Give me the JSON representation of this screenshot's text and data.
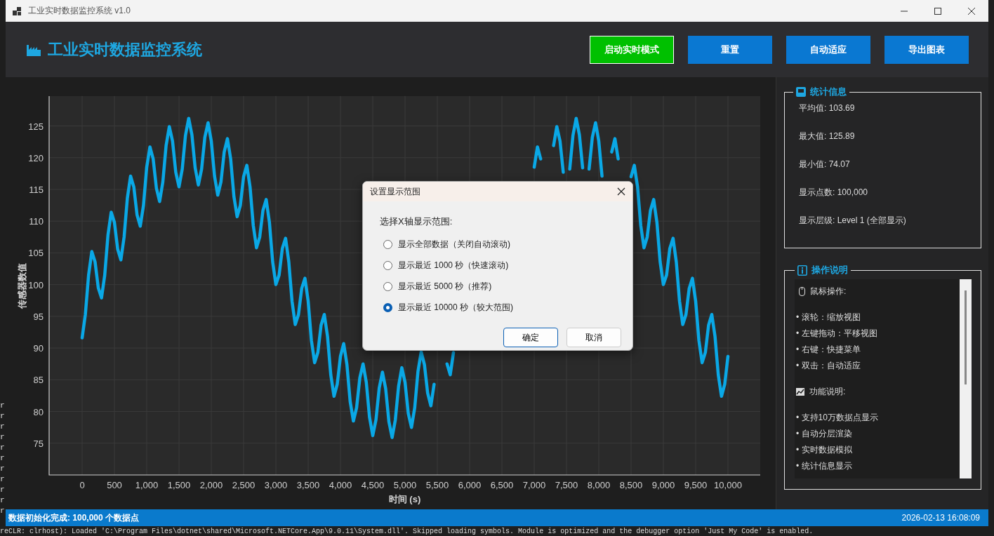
{
  "background": {
    "left_edge_fragments": [
      "r",
      "r",
      "r",
      "r",
      "r",
      "r",
      "r",
      "r",
      "r",
      "r",
      "r"
    ],
    "output_line": "reCLR: clrhost): Loaded 'C:\\Program Files\\dotnet\\shared\\Microsoft.NETCore.App\\9.0.11\\System.dll'. Skipped loading symbols. Module is optimized and the debugger option 'Just My Code' is enabled."
  },
  "window": {
    "title": "工业实时数据监控系统 v1.0"
  },
  "header": {
    "title": "工业实时数据监控系统",
    "buttons": [
      {
        "label": "启动实时模式",
        "kind": "start"
      },
      {
        "label": "重置",
        "kind": "action"
      },
      {
        "label": "自动适应",
        "kind": "action"
      },
      {
        "label": "导出图表",
        "kind": "action"
      }
    ]
  },
  "chart": {
    "chart_data": {
      "type": "line",
      "grid": true,
      "xlabel": "时间 (s)",
      "ylabel": "传感器数值",
      "xlim": [
        -511,
        10500
      ],
      "ylim": [
        70,
        129.7
      ],
      "xticks": [
        {
          "value": 0,
          "label": "0"
        },
        {
          "value": 500,
          "label": "500"
        },
        {
          "value": 1000,
          "label": "1,000"
        },
        {
          "value": 1500,
          "label": "1,500"
        },
        {
          "value": 2000,
          "label": "2,000"
        },
        {
          "value": 2500,
          "label": "2,500"
        },
        {
          "value": 3000,
          "label": "3,000"
        },
        {
          "value": 3500,
          "label": "3,500"
        },
        {
          "value": 4000,
          "label": "4,000"
        },
        {
          "value": 4500,
          "label": "4,500"
        },
        {
          "value": 5000,
          "label": "5,000"
        },
        {
          "value": 5500,
          "label": "5,500"
        },
        {
          "value": 6000,
          "label": "6,000"
        },
        {
          "value": 6500,
          "label": "6,500"
        },
        {
          "value": 7000,
          "label": "7,000"
        },
        {
          "value": 7500,
          "label": "7,500"
        },
        {
          "value": 8000,
          "label": "8,000"
        },
        {
          "value": 8500,
          "label": "8,500"
        },
        {
          "value": 9000,
          "label": "9,000"
        },
        {
          "value": 9500,
          "label": "9,500"
        },
        {
          "value": 10000,
          "label": "10,000"
        }
      ],
      "yticks": [
        75,
        80,
        85,
        90,
        95,
        100,
        105,
        110,
        115,
        120,
        125
      ],
      "x": [
        0,
        50,
        100,
        150,
        200,
        250,
        300,
        350,
        400,
        450,
        500,
        550,
        600,
        650,
        700,
        750,
        800,
        850,
        900,
        950,
        1000,
        1050,
        1100,
        1150,
        1200,
        1250,
        1300,
        1350,
        1400,
        1450,
        1500,
        1550,
        1600,
        1650,
        1700,
        1750,
        1800,
        1850,
        1900,
        1950,
        2000,
        2050,
        2100,
        2150,
        2200,
        2250,
        2300,
        2350,
        2400,
        2450,
        2500,
        2550,
        2600,
        2650,
        2700,
        2750,
        2800,
        2850,
        2900,
        2950,
        3000,
        3050,
        3100,
        3150,
        3200,
        3250,
        3300,
        3350,
        3400,
        3450,
        3500,
        3550,
        3600,
        3650,
        3700,
        3750,
        3800,
        3850,
        3900,
        3950,
        4000,
        4050,
        4100,
        4150,
        4200,
        4250,
        4300,
        4350,
        4400,
        4450,
        4500,
        4550,
        4600,
        4650,
        4700,
        4750,
        4800,
        4850,
        4900,
        4950,
        5000,
        5050,
        5100,
        5150,
        5200,
        5250,
        5300,
        5350,
        5400,
        5450,
        5500,
        5550,
        5600,
        5650,
        5700,
        5750,
        5800,
        5850,
        5900,
        5950,
        6000,
        6050,
        6100,
        6150,
        6200,
        6250,
        6300,
        6350,
        6400,
        6450,
        6500,
        6550,
        6600,
        6650,
        6700,
        6750,
        6800,
        6850,
        6900,
        6950,
        7000,
        7050,
        7100,
        7150,
        7200,
        7250,
        7300,
        7350,
        7400,
        7450,
        7500,
        7550,
        7600,
        7650,
        7700,
        7750,
        7800,
        7850,
        7900,
        7950,
        8000,
        8050,
        8100,
        8150,
        8200,
        8250,
        8300,
        8350,
        8400,
        8450,
        8500,
        8550,
        8600,
        8650,
        8700,
        8750,
        8800,
        8850,
        8900,
        8950,
        9000,
        9050,
        9100,
        9150,
        9200,
        9250,
        9300,
        9350,
        9400,
        9450,
        9500,
        9550,
        9600,
        9650,
        9700,
        9750,
        9800,
        9850,
        9900,
        9950,
        10000
      ],
      "series": [
        {
          "color": "#0aa8e6",
          "values": [
            91.6,
            95.3,
            101.5,
            105.2,
            103.6,
            99.5,
            97.9,
            101.5,
            107.8,
            111.4,
            109.8,
            105.6,
            103.9,
            107.5,
            113.6,
            117.1,
            115.4,
            111.0,
            109.2,
            112.5,
            118.5,
            121.7,
            119.8,
            115.2,
            113.1,
            116.2,
            121.9,
            124.9,
            122.6,
            117.7,
            115.4,
            118.2,
            123.5,
            126.2,
            123.6,
            118.4,
            115.7,
            118.2,
            123.2,
            125.5,
            122.6,
            117.1,
            114.1,
            116.2,
            120.9,
            123.0,
            119.8,
            113.9,
            110.7,
            112.5,
            117.0,
            118.8,
            115.4,
            109.3,
            105.8,
            107.5,
            111.7,
            113.4,
            109.8,
            103.6,
            100.0,
            101.5,
            105.7,
            107.3,
            103.6,
            97.4,
            93.7,
            95.3,
            99.4,
            101.0,
            97.4,
            91.2,
            87.7,
            89.3,
            93.6,
            95.3,
            91.8,
            85.8,
            82.4,
            84.3,
            88.7,
            90.7,
            87.4,
            81.6,
            78.5,
            80.6,
            85.3,
            87.5,
            84.6,
            79.1,
            76.2,
            78.7,
            83.7,
            86.2,
            83.6,
            78.4,
            75.9,
            78.7,
            84.0,
            86.9,
            84.6,
            79.7,
            77.5,
            80.6,
            86.3,
            89.4,
            87.4,
            82.9,
            80.9,
            84.3,
            null,
            null,
            null,
            87.5,
            85.8,
            89.3,
            null,
            null,
            null,
            null,
            null,
            null,
            null,
            null,
            null,
            null,
            null,
            null,
            null,
            null,
            null,
            null,
            null,
            null,
            null,
            null,
            null,
            null,
            null,
            null,
            118.5,
            121.7,
            119.8,
            null,
            null,
            null,
            121.9,
            124.9,
            122.6,
            117.7,
            null,
            118.2,
            123.5,
            126.2,
            123.6,
            118.4,
            null,
            118.2,
            123.2,
            125.5,
            122.6,
            117.1,
            null,
            null,
            120.9,
            123.0,
            119.8,
            null,
            null,
            null,
            117.0,
            118.8,
            115.4,
            109.3,
            105.8,
            107.5,
            111.7,
            113.4,
            109.8,
            103.6,
            100.0,
            101.5,
            105.7,
            107.3,
            103.6,
            97.4,
            93.7,
            95.3,
            99.4,
            101.0,
            97.4,
            91.2,
            87.7,
            89.3,
            93.6,
            95.3,
            91.8,
            85.8,
            82.4,
            84.3,
            88.7
          ]
        }
      ]
    }
  },
  "stats": {
    "title": "统计信息",
    "items": [
      "平均值: 103.69",
      "最大值: 125.89",
      "最小值: 74.07",
      "显示点数: 100,000",
      "显示层级: Level 1 (全部显示)"
    ]
  },
  "help": {
    "title": "操作说明",
    "items": [
      {
        "kind": "mouse_heading",
        "text": "鼠标操作:"
      },
      {
        "kind": "bullet",
        "text": "• 滚轮：缩放视图"
      },
      {
        "kind": "bullet",
        "text": "• 左键拖动：平移视图"
      },
      {
        "kind": "bullet",
        "text": "• 右键：快捷菜单"
      },
      {
        "kind": "bullet",
        "text": "• 双击：自动适应"
      },
      {
        "kind": "feature_heading",
        "text": "功能说明:"
      },
      {
        "kind": "bullet",
        "text": "• 支持10万数据点显示"
      },
      {
        "kind": "bullet",
        "text": "• 自动分层渲染"
      },
      {
        "kind": "bullet",
        "text": "• 实时数据模拟"
      },
      {
        "kind": "bullet",
        "text": "• 统计信息显示"
      }
    ]
  },
  "dialog": {
    "title": "设置显示范围",
    "prompt": "选择X轴显示范围:",
    "options": [
      {
        "label": "显示全部数据（关闭自动滚动)",
        "selected": false
      },
      {
        "label": "显示最近 1000 秒（快速滚动)",
        "selected": false
      },
      {
        "label": "显示最近 5000 秒（推荐)",
        "selected": false
      },
      {
        "label": "显示最近 10000 秒（较大范围)",
        "selected": true
      }
    ],
    "buttons": [
      {
        "label": "确定",
        "kind": "default"
      },
      {
        "label": "取消",
        "kind": "normal"
      }
    ]
  },
  "status_bar": {
    "message": "数据初始化完成: 100,000 个数据点",
    "time": "2026-02-13 16:08:09"
  }
}
